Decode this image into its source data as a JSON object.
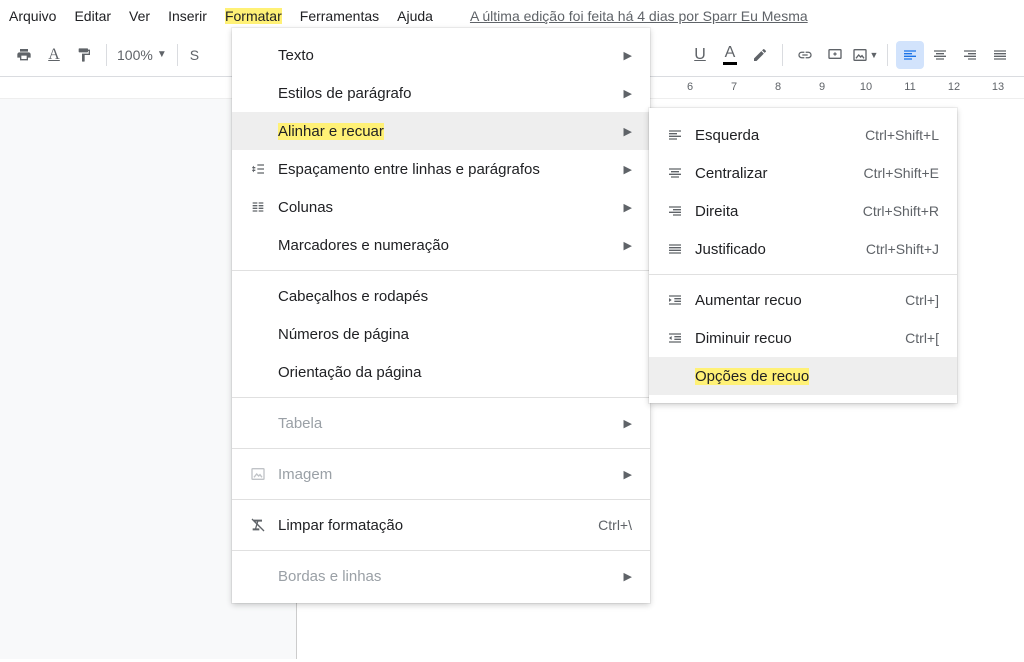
{
  "menubar": {
    "arquivo": "Arquivo",
    "editar": "Editar",
    "ver": "Ver",
    "inserir": "Inserir",
    "formatar": "Formatar",
    "ferramentas": "Ferramentas",
    "ajuda": "Ajuda",
    "edit_info": "A última edição foi feita há 4 dias por Sparr Eu Mesma"
  },
  "toolbar": {
    "zoom": "100%",
    "styles_prefix": "S"
  },
  "ruler": {
    "marks": [
      "6",
      "7",
      "8",
      "9",
      "10",
      "11",
      "12",
      "13"
    ]
  },
  "format_menu": {
    "texto": "Texto",
    "estilos": "Estilos de parágrafo",
    "alinhar": "Alinhar e recuar",
    "espacamento": "Espaçamento entre linhas e parágrafos",
    "colunas": "Colunas",
    "marcadores": "Marcadores e numeração",
    "cabecalhos": "Cabeçalhos e rodapés",
    "numeros": "Números de página",
    "orientacao": "Orientação da página",
    "tabela": "Tabela",
    "imagem": "Imagem",
    "limpar": "Limpar formatação",
    "limpar_shortcut": "Ctrl+\\",
    "bordas": "Bordas e linhas"
  },
  "align_submenu": {
    "esquerda": "Esquerda",
    "esquerda_sc": "Ctrl+Shift+L",
    "centralizar": "Centralizar",
    "centralizar_sc": "Ctrl+Shift+E",
    "direita": "Direita",
    "direita_sc": "Ctrl+Shift+R",
    "justificado": "Justificado",
    "justificado_sc": "Ctrl+Shift+J",
    "aumentar": "Aumentar recuo",
    "aumentar_sc": "Ctrl+]",
    "diminuir": "Diminuir recuo",
    "diminuir_sc": "Ctrl+[",
    "opcoes": "Opções de recuo"
  }
}
